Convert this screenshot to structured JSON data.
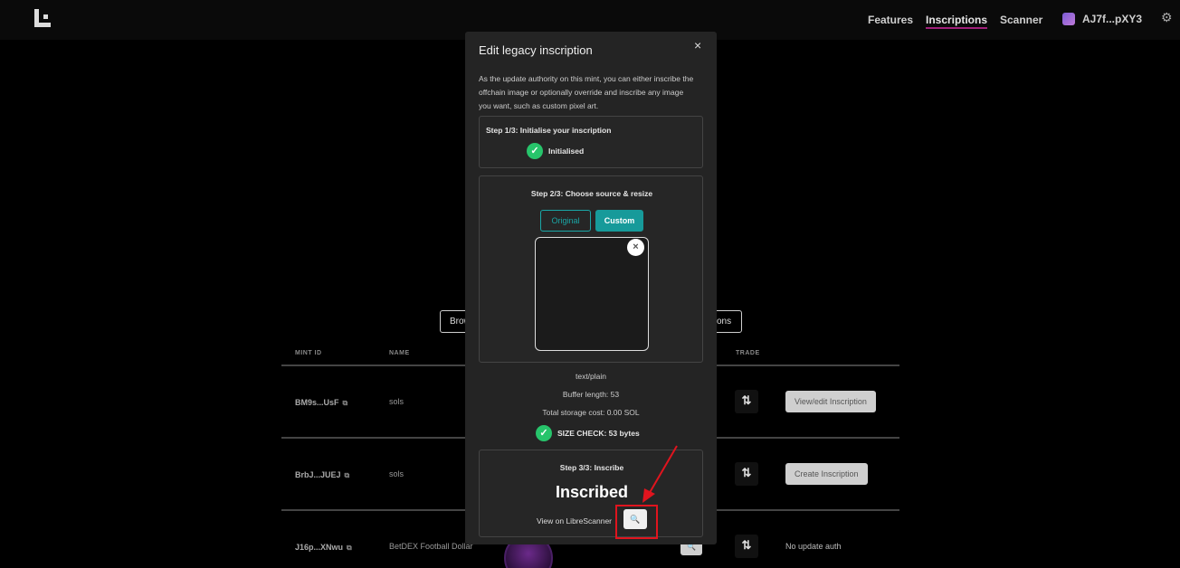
{
  "nav": {
    "links": [
      "Features",
      "Inscriptions",
      "Scanner"
    ],
    "wallet": "AJ7f...pXY3"
  },
  "background": {
    "buttons": [
      "Brow",
      "tions"
    ],
    "columns": [
      "MINT ID",
      "NAME",
      "TRADE"
    ],
    "rows": [
      {
        "mint": "BM9s...UsF",
        "name": "sols",
        "action": "View/edit Inscription"
      },
      {
        "mint": "BrbJ...JUEJ",
        "name": "sols",
        "action": "Create Inscription"
      },
      {
        "mint": "J16p...XNwu",
        "name": "BetDEX Football Dollar",
        "action": "No update auth"
      }
    ]
  },
  "modal": {
    "title": "Edit legacy inscription",
    "close": "×",
    "description": "As the update authority on this mint, you can either inscribe the offchain image or optionally override and inscribe any image you want, such as custom pixel art.",
    "step1": {
      "title": "Step 1/3: Initialise your inscription",
      "status": "Initialised"
    },
    "step2": {
      "title": "Step 2/3: Choose source & resize",
      "tabs": [
        "Original",
        "Custom"
      ],
      "selected_tab": "Custom"
    },
    "info": {
      "mime": "text/plain",
      "buffer": "Buffer length: 53",
      "cost": "Total storage cost: 0.00 SOL",
      "size_check": "SIZE CHECK: 53 bytes"
    },
    "step3": {
      "title": "Step 3/3: Inscribe",
      "status": "Inscribed",
      "view_on": "View on LibreScanner"
    }
  },
  "colors": {
    "accent": "#179a9a",
    "success": "#27c46b",
    "highlight": "#e0141e",
    "nav_underline": "#a0207a"
  },
  "icons": [
    "logo-icon",
    "gear-icon",
    "copy-icon",
    "trade-icon",
    "check-icon",
    "close-icon",
    "search-icon",
    "arrow-annotation-icon"
  ]
}
